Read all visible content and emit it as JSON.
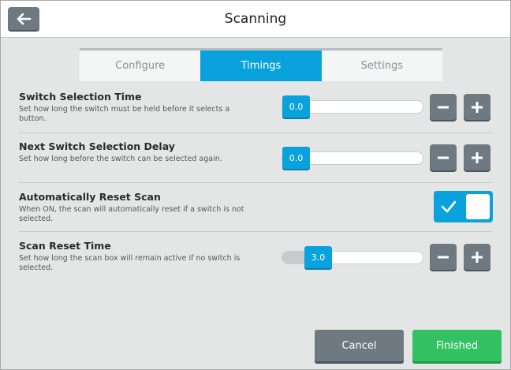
{
  "header": {
    "title": "Scanning",
    "back_icon": "arrow-left-icon"
  },
  "tabs": [
    {
      "label": "Configure",
      "active": false
    },
    {
      "label": "Timings",
      "active": true
    },
    {
      "label": "Settings",
      "active": false
    }
  ],
  "settings": {
    "switch_selection_time": {
      "title": "Switch Selection Time",
      "description": "Set how long the switch must be held before it selects a button.",
      "value": "0.0"
    },
    "next_switch_selection_delay": {
      "title": "Next Switch Selection Delay",
      "description": "Set how long before the switch can be selected again.",
      "value": "0.0"
    },
    "automatically_reset_scan": {
      "title": "Automatically Reset Scan",
      "description": "When ON, the scan will automatically reset if a switch is not selected.",
      "enabled": true
    },
    "scan_reset_time": {
      "title": "Scan Reset Time",
      "description": "Set how long the scan box will remain active if no switch is selected.",
      "value": "3.0"
    }
  },
  "footer": {
    "cancel_label": "Cancel",
    "finished_label": "Finished"
  },
  "colors": {
    "accent": "#0aa2dc",
    "button_gray": "#6e7982",
    "finish_green": "#34c163",
    "background": "#e4e6e6"
  }
}
